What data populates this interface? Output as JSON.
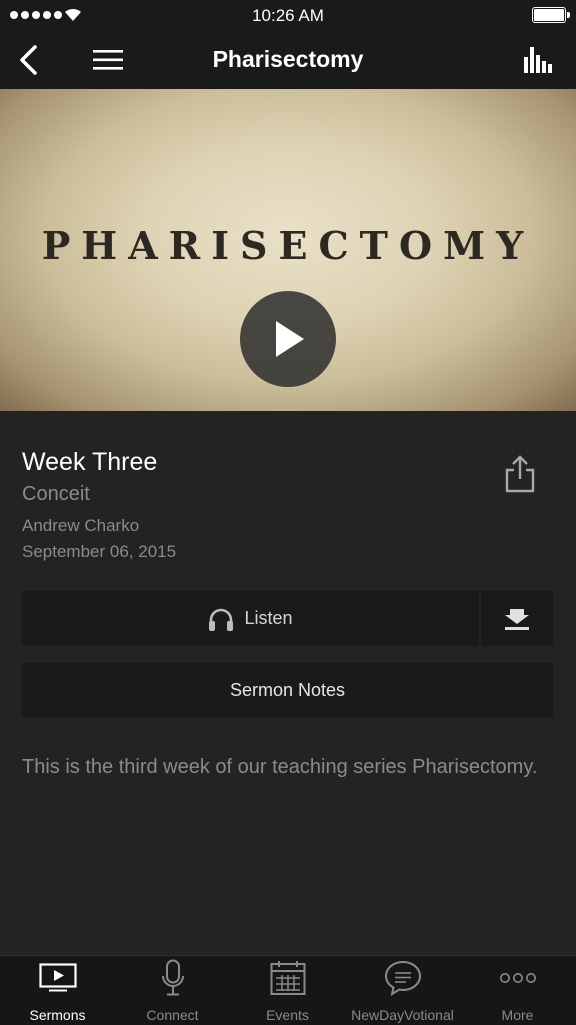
{
  "status_bar": {
    "time": "10:26 AM"
  },
  "nav": {
    "title": "Pharisectomy"
  },
  "hero": {
    "text": "PHARISECTOMY"
  },
  "sermon": {
    "title": "Week Three",
    "subtitle": "Conceit",
    "speaker": "Andrew Charko",
    "date": "September 06, 2015",
    "description": "This is the third week of our teaching series Pharisectomy."
  },
  "actions": {
    "listen_label": "Listen",
    "notes_label": "Sermon Notes"
  },
  "tabs": [
    {
      "label": "Sermons",
      "icon": "tv-play-icon",
      "active": true
    },
    {
      "label": "Connect",
      "icon": "microphone-icon",
      "active": false
    },
    {
      "label": "Events",
      "icon": "calendar-icon",
      "active": false
    },
    {
      "label": "NewDayVotional",
      "icon": "speech-bubble-icon",
      "active": false
    },
    {
      "label": "More",
      "icon": "more-dots-icon",
      "active": false
    }
  ]
}
